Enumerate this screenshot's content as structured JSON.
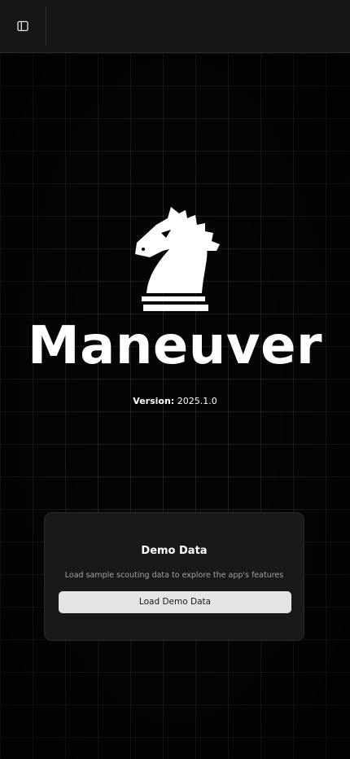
{
  "topbar": {
    "toggle_icon": "sidebar-panel-icon"
  },
  "hero": {
    "logo_icon": "chess-knight-icon",
    "app_name": "Maneuver",
    "version_label": "Version:",
    "version_value": "2025.1.0"
  },
  "demo_card": {
    "title": "Demo Data",
    "description": "Load sample scouting data to explore the app's features",
    "button_label": "Load Demo Data"
  },
  "colors": {
    "background": "#000000",
    "topbar": "#161618",
    "card": "#19191b",
    "button": "#e4e4e7",
    "muted_text": "#a1a1a8"
  }
}
